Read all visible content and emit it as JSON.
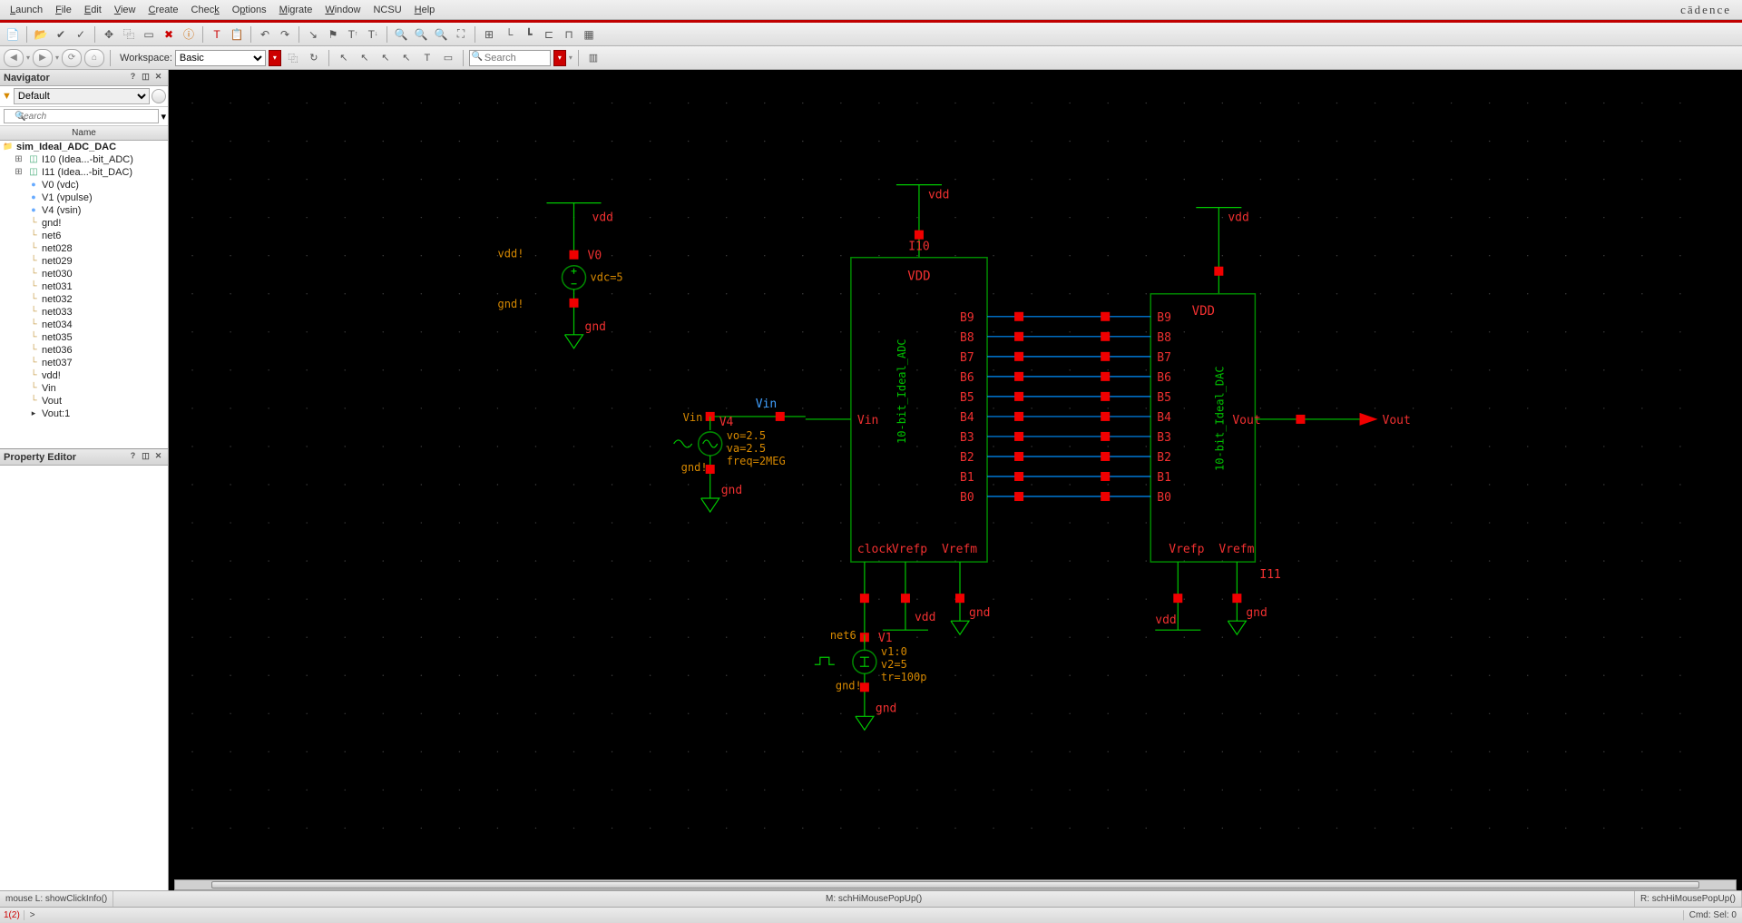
{
  "brand": "cādence",
  "menus": [
    "Launch",
    "File",
    "Edit",
    "View",
    "Create",
    "Check",
    "Options",
    "Migrate",
    "Window",
    "NCSU",
    "Help"
  ],
  "workspace": {
    "label": "Workspace:",
    "value": "Basic"
  },
  "search_placeholder": "Search",
  "navigator": {
    "title": "Navigator",
    "filter_value": "Default",
    "search_placeholder": "Search",
    "col": "Name",
    "root": "sim_Ideal_ADC_DAC",
    "items": [
      {
        "icon": "block",
        "indent": 1,
        "label": "I10 (Idea...-bit_ADC)",
        "expand": true
      },
      {
        "icon": "block",
        "indent": 1,
        "label": "I11 (Idea...-bit_DAC)",
        "expand": true
      },
      {
        "icon": "circle",
        "indent": 1,
        "label": "V0 (vdc)"
      },
      {
        "icon": "circle",
        "indent": 1,
        "label": "V1 (vpulse)"
      },
      {
        "icon": "circle",
        "indent": 1,
        "label": "V4 (vsin)"
      },
      {
        "icon": "net",
        "indent": 1,
        "label": "gnd!"
      },
      {
        "icon": "net",
        "indent": 1,
        "label": "net6"
      },
      {
        "icon": "net",
        "indent": 1,
        "label": "net028"
      },
      {
        "icon": "net",
        "indent": 1,
        "label": "net029"
      },
      {
        "icon": "net",
        "indent": 1,
        "label": "net030"
      },
      {
        "icon": "net",
        "indent": 1,
        "label": "net031"
      },
      {
        "icon": "net",
        "indent": 1,
        "label": "net032"
      },
      {
        "icon": "net",
        "indent": 1,
        "label": "net033"
      },
      {
        "icon": "net",
        "indent": 1,
        "label": "net034"
      },
      {
        "icon": "net",
        "indent": 1,
        "label": "net035"
      },
      {
        "icon": "net",
        "indent": 1,
        "label": "net036"
      },
      {
        "icon": "net",
        "indent": 1,
        "label": "net037"
      },
      {
        "icon": "net",
        "indent": 1,
        "label": "vdd!"
      },
      {
        "icon": "net",
        "indent": 1,
        "label": "Vin"
      },
      {
        "icon": "net",
        "indent": 1,
        "label": "Vout"
      },
      {
        "icon": "pin",
        "indent": 1,
        "label": "Vout:1"
      }
    ]
  },
  "property_editor": {
    "title": "Property Editor"
  },
  "status": {
    "left": "mouse L: showClickInfo()",
    "center": "M: schHiMousePopUp()",
    "right": "R: schHiMousePopUp()"
  },
  "cmd": {
    "count": "1(2)",
    "prompt": ">",
    "sel": "Cmd: Sel: 0"
  },
  "schematic": {
    "v0": {
      "name": "V0",
      "vdd": "vdd!",
      "gnd": "gnd!",
      "param": "vdc=5",
      "net_top": "vdd",
      "net_bot": "gnd"
    },
    "v4": {
      "name": "V4",
      "pin": "Vin",
      "gnd": "gnd!",
      "p1": "vo=2.5",
      "p2": "va=2.5",
      "p3": "freq=2MEG",
      "net_label": "Vin",
      "net_bot": "gnd"
    },
    "v1": {
      "name": "V1",
      "pin": "net6",
      "gnd": "gnd!",
      "p1": "v1:0",
      "p2": "v2=5",
      "p3": "tr=100p",
      "net_bot": "gnd"
    },
    "adc": {
      "inst": "I10",
      "title": "VDD",
      "side": "10-bit_Ideal_ADC",
      "pins_left": [
        "Vin",
        "clock"
      ],
      "pins_right": [
        "B9",
        "B8",
        "B7",
        "B6",
        "B5",
        "B4",
        "B3",
        "B2",
        "B1",
        "B0"
      ],
      "pins_bot": [
        "Vrefp",
        "Vrefm"
      ],
      "top_net": "vdd",
      "vrefp_net": "vdd",
      "vrefm_net": "gnd"
    },
    "dac": {
      "inst": "I11",
      "title": "VDD",
      "side": "10-bit_Ideal_DAC",
      "pins_left": [
        "B9",
        "B8",
        "B7",
        "B6",
        "B5",
        "B4",
        "B3",
        "B2",
        "B1",
        "B0"
      ],
      "pins_right": [
        "Vout"
      ],
      "pins_bot": [
        "Vrefp",
        "Vrefm"
      ],
      "top_net": "vdd",
      "vrefp_net": "vdd",
      "vrefm_net": "gnd",
      "out_label": "Vout"
    }
  }
}
